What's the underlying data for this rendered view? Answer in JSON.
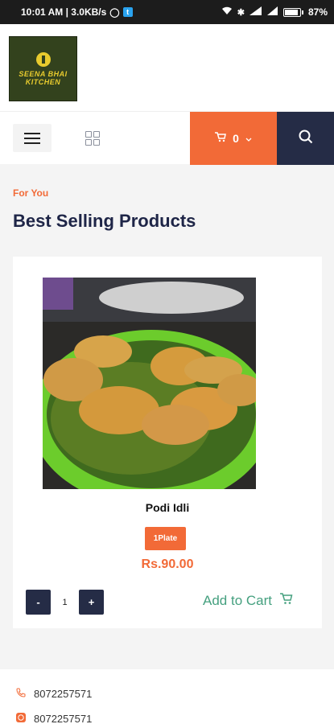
{
  "status_bar": {
    "time_speed": "10:01 AM | 3.0KB/s",
    "battery": "87%"
  },
  "logo": {
    "line1": "SEENA BHAI",
    "line2": "KITCHEN"
  },
  "navbar": {
    "cart_count": "0"
  },
  "section": {
    "kicker": "For You",
    "title": "Best Selling Products"
  },
  "product": {
    "name": "Podi Idli",
    "variant": "1Plate",
    "price": "Rs.90.00",
    "qty_minus": "-",
    "qty_value": "1",
    "qty_plus": "+",
    "add_to_cart": "Add to Cart"
  },
  "footer": {
    "phone1": "8072257571",
    "phone2": "8072257571"
  },
  "colors": {
    "accent": "#f26a37",
    "navy": "#252c46",
    "green": "#45a07f"
  }
}
